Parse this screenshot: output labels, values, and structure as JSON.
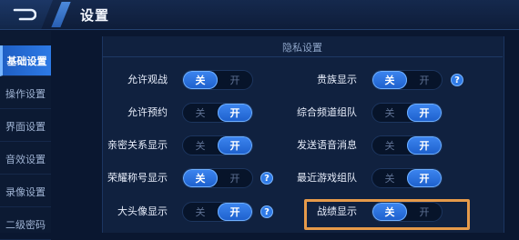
{
  "header": {
    "title": "设置",
    "back_icon": "back-arrow-icon"
  },
  "sidebar": {
    "items": [
      {
        "label": "基础设置",
        "active": true
      },
      {
        "label": "操作设置",
        "active": false
      },
      {
        "label": "界面设置",
        "active": false
      },
      {
        "label": "音效设置",
        "active": false
      },
      {
        "label": "录像设置",
        "active": false
      },
      {
        "label": "二级密码",
        "active": false
      }
    ]
  },
  "section": {
    "title": "隐私设置"
  },
  "toggle_labels": {
    "off": "关",
    "on": "开"
  },
  "left_settings": [
    {
      "label": "允许观战",
      "value": "off",
      "help": false
    },
    {
      "label": "允许预约",
      "value": "on",
      "help": false
    },
    {
      "label": "亲密关系显示",
      "value": "on",
      "help": false
    },
    {
      "label": "荣耀称号显示",
      "value": "off",
      "help": true
    },
    {
      "label": "大头像显示",
      "value": "on",
      "help": true
    }
  ],
  "right_settings": [
    {
      "label": "贵族显示",
      "value": "off",
      "help": true
    },
    {
      "label": "综合频道组队",
      "value": "on",
      "help": false
    },
    {
      "label": "发送语音消息",
      "value": "on",
      "help": false
    },
    {
      "label": "最近游戏组队",
      "value": "on",
      "help": false
    },
    {
      "label": "战绩显示",
      "value": "off",
      "help": false,
      "highlighted": true
    }
  ],
  "help_symbol": "?",
  "colors": {
    "accent": "#2d7ae6",
    "highlight": "#e69a4a",
    "background": "#0a1730"
  }
}
